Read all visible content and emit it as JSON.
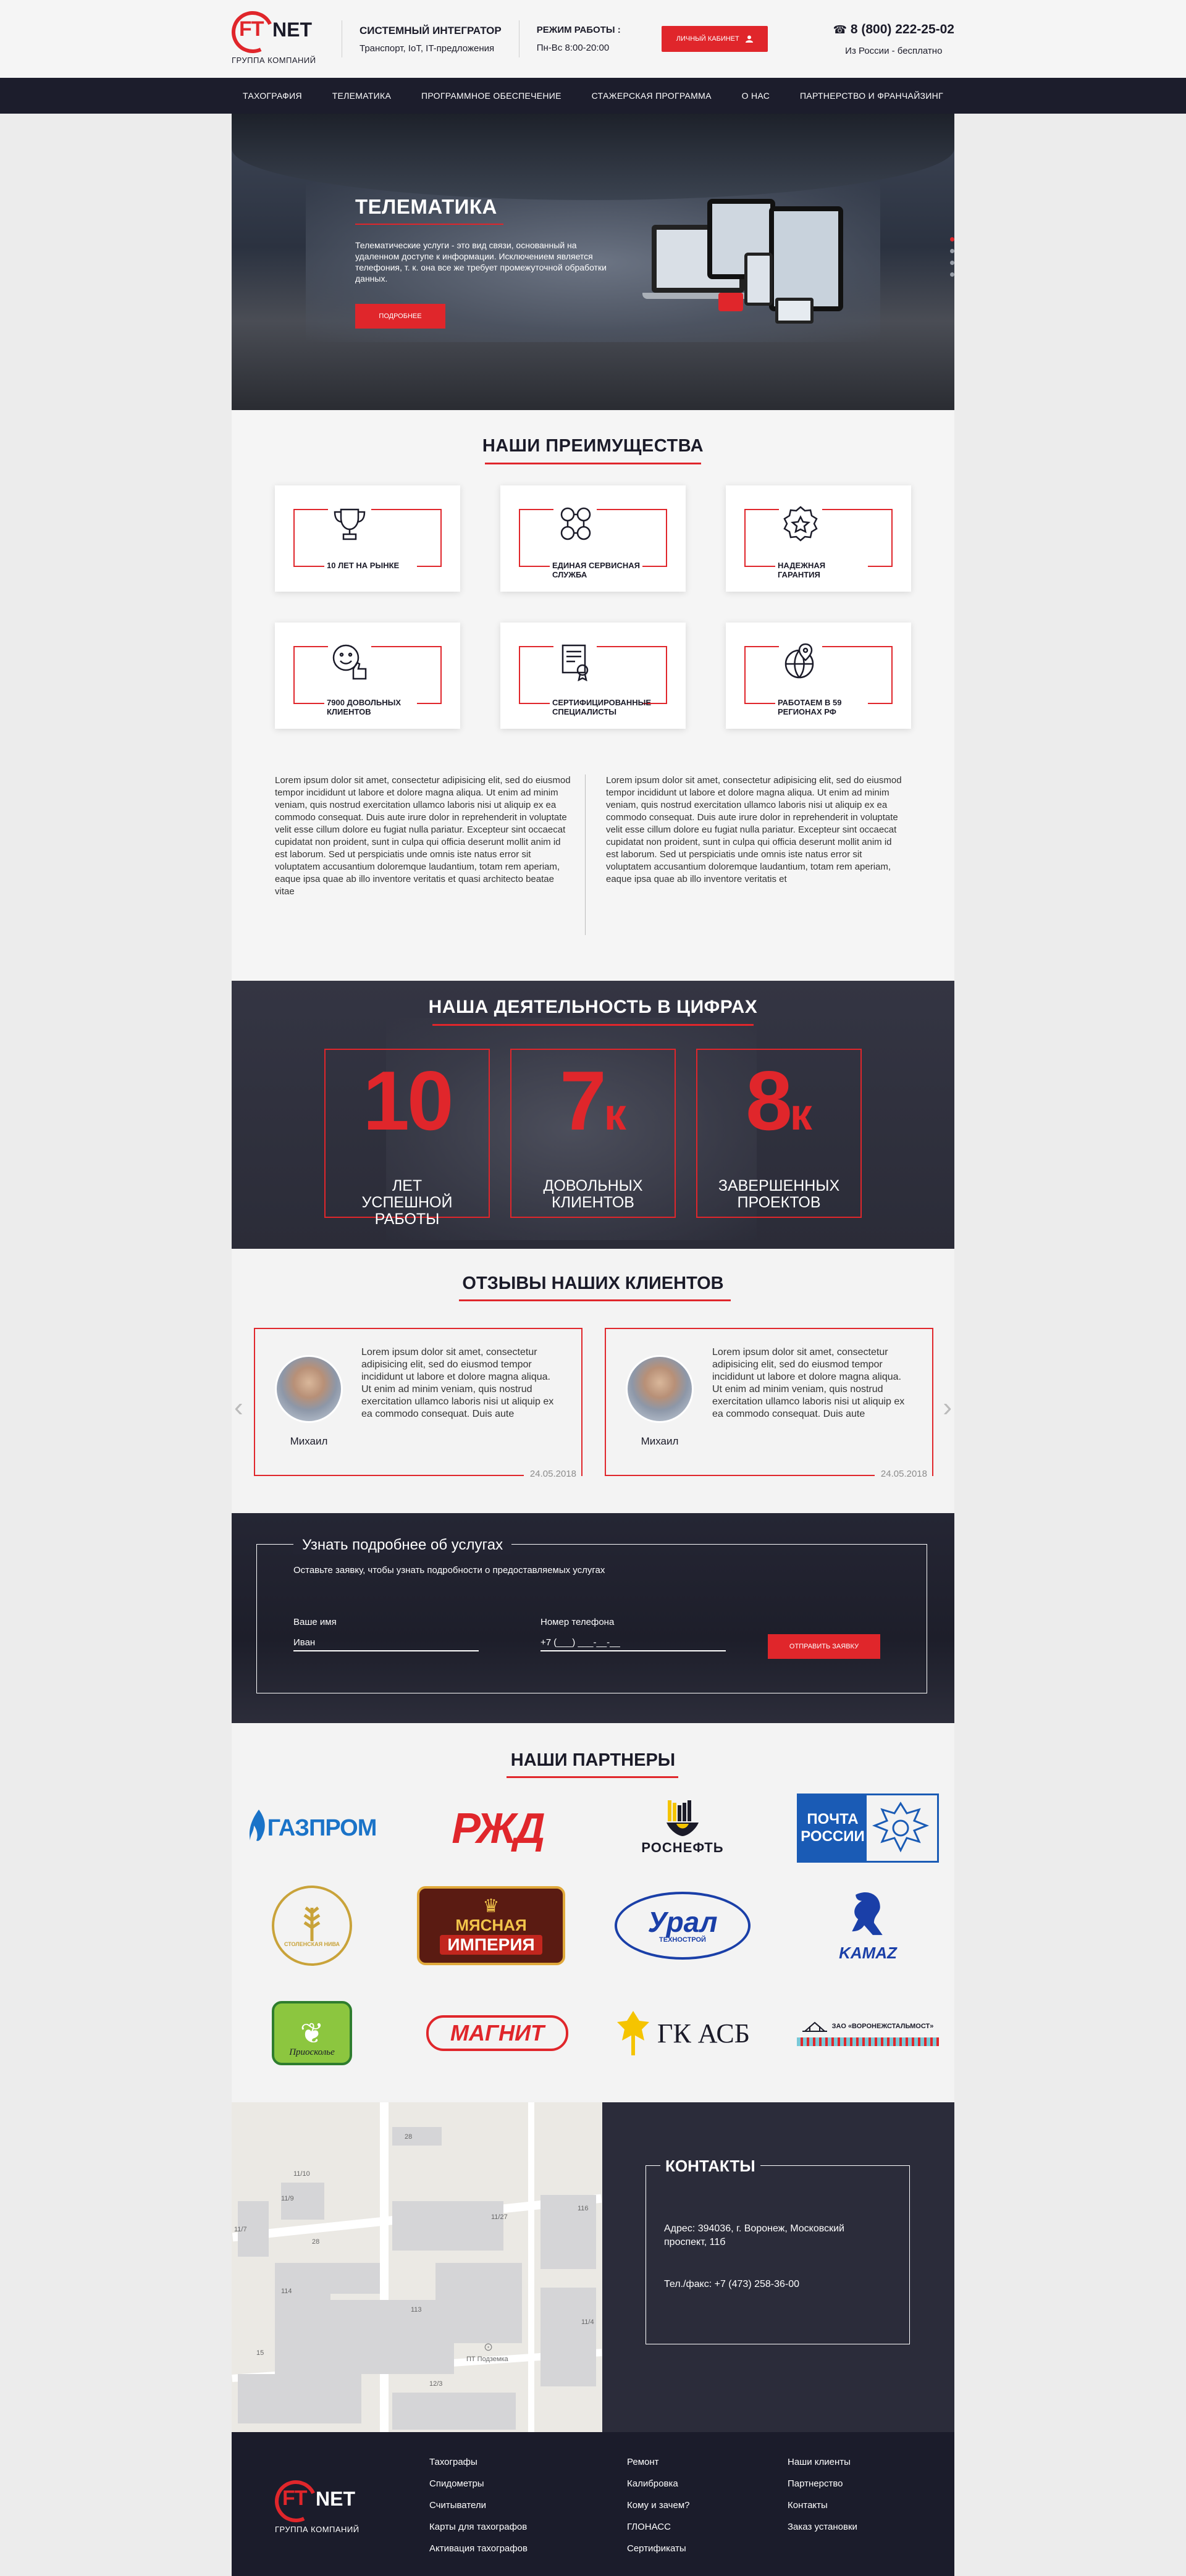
{
  "header": {
    "logo_ft": "FT",
    "logo_net": "NET",
    "logo_sub": "ГРУППА КОМПАНИЙ",
    "integrator_title": "СИСТЕМНЫЙ ИНТЕГРАТОР",
    "integrator_sub": "Транспорт, IoT, IT-предложения",
    "hours_title": "РЕЖИМ РАБОТЫ :",
    "hours_value": "Пн-Вс 8:00-20:00",
    "cabinet_label": "ЛИЧНЫЙ КАБИНЕТ",
    "phone": "8 (800) 222-25-02",
    "phone_note": "Из России - бесплатно"
  },
  "nav": [
    "ТАХОГРАФИЯ",
    "ТЕЛЕМАТИКА",
    "ПРОГРАММНОЕ ОБЕСПЕЧЕНИЕ",
    "СТАЖЕРСКАЯ ПРОГРАММА",
    "О НАС",
    "ПАРТНЕРСТВО И ФРАНЧАЙЗИНГ"
  ],
  "hero": {
    "title": "ТЕЛЕМАТИКА",
    "text": "Телематические услуги - это вид связи, основанный на удаленном доступе к информации. Исключением является телефония, т. к. она все же требует промежуточной обработки данных.",
    "button": "ПОДРОБНЕЕ"
  },
  "advantages": {
    "title": "НАШИ ПРЕИМУЩЕСТВА",
    "items": [
      {
        "label": "10 ЛЕТ НА РЫНКЕ",
        "icon": "trophy-icon"
      },
      {
        "label": "ЕДИНАЯ СЕРВИСНАЯ СЛУЖБА",
        "icon": "team-icon"
      },
      {
        "label": "НАДЕЖНАЯ ГАРАНТИЯ",
        "icon": "star-badge-icon"
      },
      {
        "label": "7900 ДОВОЛЬНЫХ КЛИЕНТОВ",
        "icon": "smile-thumb-icon"
      },
      {
        "label": "СЕРТИФИЦИРОВАННЫЕ СПЕЦИАЛИСТЫ",
        "icon": "certificate-icon"
      },
      {
        "label": "РАБОТАЕМ В 59 РЕГИОНАХ РФ",
        "icon": "globe-pin-icon"
      }
    ],
    "text_left": "Lorem ipsum dolor sit amet, consectetur adipisicing elit, sed do eiusmod tempor incididunt ut labore et dolore magna aliqua. Ut enim ad minim veniam, quis nostrud exercitation ullamco laboris nisi ut aliquip ex ea commodo consequat. Duis aute irure dolor in reprehenderit in voluptate velit esse cillum dolore eu fugiat nulla pariatur. Excepteur sint occaecat cupidatat non proident, sunt in culpa qui officia deserunt mollit anim id est laborum. Sed ut perspiciatis unde omnis iste natus error sit voluptatem accusantium doloremque laudantium, totam rem aperiam, eaque ipsa quae ab illo inventore veritatis et quasi architecto beatae vitae",
    "text_right": "Lorem ipsum dolor sit amet, consectetur adipisicing elit, sed do eiusmod tempor incididunt ut labore et dolore magna aliqua. Ut enim ad minim veniam, quis nostrud exercitation ullamco laboris nisi ut aliquip ex ea commodo consequat. Duis aute irure dolor in reprehenderit in voluptate velit esse cillum dolore eu fugiat nulla pariatur. Excepteur sint occaecat cupidatat non proident, sunt in culpa qui officia deserunt mollit anim id est laborum. Sed ut perspiciatis unde omnis iste natus error sit voluptatem accusantium doloremque laudantium, totam rem aperiam, eaque ipsa quae ab illo inventore veritatis et"
  },
  "stats": {
    "title": "НАША ДЕЯТЕЛЬНОСТЬ В ЦИФРАХ",
    "items": [
      {
        "num": "10",
        "suffix": "",
        "label": "ЛЕТ УСПЕШНОЙ РАБОТЫ"
      },
      {
        "num": "7",
        "suffix": "к",
        "label": "ДОВОЛЬНЫХ КЛИЕНТОВ"
      },
      {
        "num": "8",
        "suffix": "к",
        "label": "ЗАВЕРШЕННЫХ ПРОЕКТОВ"
      }
    ]
  },
  "reviews": {
    "title": "ОТЗЫВЫ НАШИХ КЛИЕНТОВ",
    "items": [
      {
        "name": "Михаил",
        "text": "Lorem ipsum dolor sit amet, consectetur adipisicing elit, sed do eiusmod tempor incididunt ut labore et dolore magna aliqua. Ut enim ad minim veniam, quis nostrud exercitation ullamco laboris nisi ut aliquip ex ea commodo consequat. Duis aute",
        "date": "24.05.2018"
      },
      {
        "name": "Михаил",
        "text": "Lorem ipsum dolor sit amet, consectetur adipisicing elit, sed do eiusmod tempor incididunt ut labore et dolore magna aliqua. Ut enim ad minim veniam, quis nostrud exercitation ullamco laboris nisi ut aliquip ex ea commodo consequat. Duis aute",
        "date": "24.05.2018"
      }
    ],
    "prev": "‹",
    "next": "›"
  },
  "request": {
    "title": "Узнать подробнее об услугах",
    "subtitle": "Оставьте заявку, чтобы узнать подробности о предоставляемых услугах",
    "name_label": "Ваше имя",
    "name_value": "Иван",
    "phone_label": "Номер телефона",
    "phone_value": "+7 (___) ___-__-__",
    "button": "ОТПРАВИТЬ ЗАЯВКУ"
  },
  "partners": {
    "title": "НАШИ ПАРТНЕРЫ",
    "logos": {
      "gazprom": "ГАЗПРОМ",
      "rzd": "РЖД",
      "rosneft": "РОСНЕФТЬ",
      "pochta": "ПОЧТА РОССИИ",
      "stolenskaya": "СТОЛЕНСКАЯ НИВА",
      "myasnaya_1": "МЯСНАЯ",
      "myasnaya_2": "ИМПЕРИЯ",
      "ural": "Урал",
      "ural_sub": "ТЕХНОСТРОЙ",
      "kamaz": "KAMAZ",
      "prioskolye": "Приосколье",
      "magnit": "МАГНИТ",
      "gk_asb": "ГК АСБ",
      "voronezh": "ЗАО «ВОРОНЕЖСТАЛЬМОСТ»"
    }
  },
  "contacts": {
    "title": "КОНТАКТЫ",
    "address": "Адрес: 394036, г. Воронеж, Московский проспект, 11б",
    "phone": "Тел./факс: +7 (473) 258-36-00",
    "map_labels": [
      "28",
      "11/10",
      "11/9",
      "11/7",
      "28",
      "11/27",
      "116",
      "114",
      "113",
      "11/4",
      "15",
      "12/3",
      "ПТ Подземка"
    ]
  },
  "footer": {
    "logo_ft": "FT",
    "logo_net": "NET",
    "logo_sub": "ГРУППА КОМПАНИЙ",
    "col1": [
      "Тахографы",
      "Спидометры",
      "Считыватели",
      "Карты для тахографов",
      "Активация тахографов"
    ],
    "col2": [
      "Ремонт",
      "Калибровка",
      "Кому и зачем?",
      "ГЛОНАСС",
      "Сертификаты"
    ],
    "col3": [
      "Наши клиенты",
      "Партнерство",
      "Контакты",
      "Заказ установки"
    ]
  },
  "colors": {
    "accent": "#e0262b",
    "dark": "#1c1d2c",
    "light_bg": "#f5f5f5"
  }
}
